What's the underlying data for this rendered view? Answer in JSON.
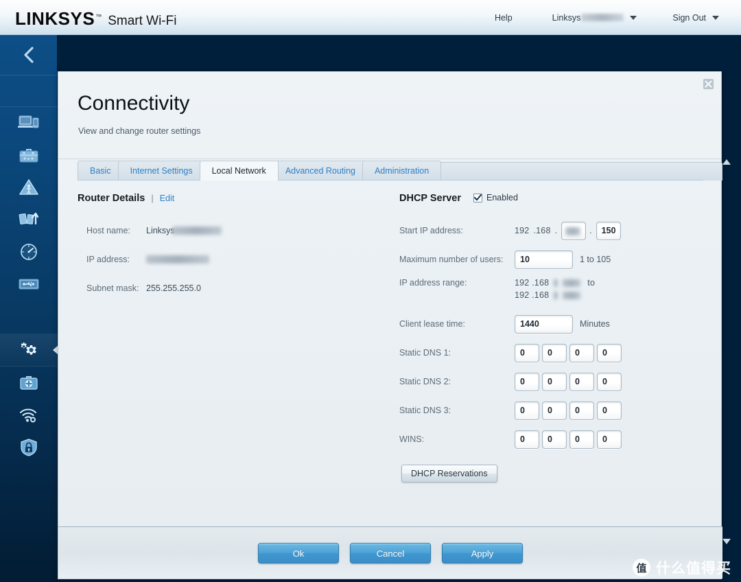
{
  "topbar": {
    "logo": "LINKSYS",
    "trademark": "™",
    "product": "Smart Wi-Fi",
    "help": "Help",
    "account": "Linksys",
    "sign_out": "Sign Out"
  },
  "sidebar": {
    "back_icon": "chevron-left-icon",
    "items": [
      {
        "name": "device-list",
        "icon": "laptop-devices-icon"
      },
      {
        "name": "guest-access",
        "icon": "suitcase-icon"
      },
      {
        "name": "parental-controls",
        "icon": "warning-triangle-icon"
      },
      {
        "name": "media-prioritization",
        "icon": "priority-arrows-icon"
      },
      {
        "name": "speed-test",
        "icon": "speedometer-icon"
      },
      {
        "name": "usb-storage",
        "icon": "usb-drive-icon"
      },
      {
        "name": "connectivity",
        "icon": "gears-icon",
        "active": true
      },
      {
        "name": "troubleshooting",
        "icon": "first-aid-kit-icon"
      },
      {
        "name": "wireless",
        "icon": "wifi-gear-icon"
      },
      {
        "name": "security",
        "icon": "shield-lock-icon"
      }
    ]
  },
  "panel": {
    "title": "Connectivity",
    "subtitle": "View and change router settings",
    "close_icon": "close-icon"
  },
  "tabs": [
    {
      "label": "Basic",
      "active": false
    },
    {
      "label": "Internet Settings",
      "active": false
    },
    {
      "label": "Local Network",
      "active": true
    },
    {
      "label": "Advanced Routing",
      "active": false
    },
    {
      "label": "Administration",
      "active": false
    }
  ],
  "router_details": {
    "title": "Router Details",
    "divider": "|",
    "edit_label": "Edit",
    "fields": [
      {
        "label": "Host name:",
        "value": "Linksys",
        "redacted": true
      },
      {
        "label": "IP address:",
        "value": "",
        "redacted": true
      },
      {
        "label": "Subnet mask:",
        "value": "255.255.255.0",
        "redacted": false
      }
    ]
  },
  "dhcp": {
    "title": "DHCP Server",
    "enabled_label": "Enabled",
    "enabled_checked": true,
    "start_ip": {
      "label": "Start IP address:",
      "prefix_1": "192",
      "prefix_2": ".168",
      "dot": ".",
      "octet3": "",
      "octet3_redacted": true,
      "octet4": "150"
    },
    "max_users": {
      "label": "Maximum number of users:",
      "value": "10",
      "hint": "1 to 105"
    },
    "ip_range": {
      "label": "IP address range:",
      "row1_prefix": "192 .168",
      "row1_suffix_redacted": true,
      "to_label": "to",
      "row2_prefix": "192 .168",
      "row2_suffix_redacted": true
    },
    "lease_time": {
      "label": "Client lease time:",
      "value": "1440",
      "unit": "Minutes"
    },
    "dns_rows": [
      {
        "label": "Static DNS 1:",
        "octets": [
          "0",
          "0",
          "0",
          "0"
        ]
      },
      {
        "label": "Static DNS 2:",
        "octets": [
          "0",
          "0",
          "0",
          "0"
        ]
      },
      {
        "label": "Static DNS 3:",
        "octets": [
          "0",
          "0",
          "0",
          "0"
        ]
      },
      {
        "label": "WINS:",
        "octets": [
          "0",
          "0",
          "0",
          "0"
        ]
      }
    ],
    "reservations_button": "DHCP Reservations"
  },
  "footer": {
    "ok": "Ok",
    "cancel": "Cancel",
    "apply": "Apply"
  },
  "watermark": {
    "badge": "值",
    "text": "什么值得买"
  }
}
